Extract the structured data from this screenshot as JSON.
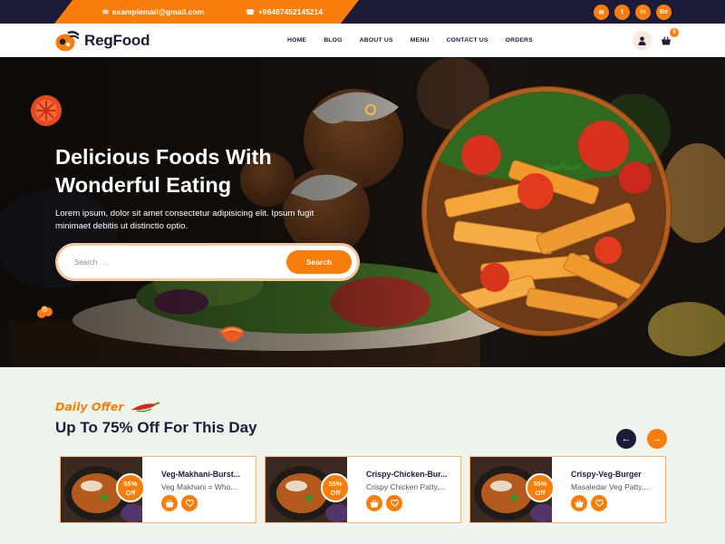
{
  "topbar": {
    "email": "examplemail@gmail.com",
    "phone": "+96487452145214",
    "socials": [
      {
        "icon": "mail-icon",
        "glyph": "✉"
      },
      {
        "icon": "twitter-icon",
        "glyph": "t"
      },
      {
        "icon": "linkedin-icon",
        "glyph": "in"
      },
      {
        "icon": "behance-icon",
        "glyph": "Be"
      }
    ]
  },
  "header": {
    "brand": "RegFood",
    "nav": [
      "HOME",
      "BLOG",
      "ABOUT US",
      "MENU",
      "CONTACT US",
      "ORDERS"
    ],
    "cart_count": "0"
  },
  "hero": {
    "title": "Delicious Foods With Wonderful Eating",
    "description": "Lorem ipsum, dolor sit amet consectetur adipisicing elit. Ipsum fugit minimaet debitis ut distinctio optio.",
    "search_placeholder": "Search . . .",
    "search_button": "Search"
  },
  "offer": {
    "tag": "Daily Offer",
    "title": "Up To 75% Off For This Day",
    "cards": [
      {
        "title": "Veg-Makhani-Burst...",
        "subtitle": "Veg Makhani = Who...",
        "badge_pct": "55%",
        "badge_off": "Off"
      },
      {
        "title": "Crispy-Chicken-Bur...",
        "subtitle": "Crispy Chicken Patty,...",
        "badge_pct": "55%",
        "badge_off": "Off"
      },
      {
        "title": "Crispy-Veg-Burger",
        "subtitle": "Masaledar Veg Patty,...",
        "badge_pct": "55%",
        "badge_off": "Off"
      }
    ]
  },
  "colors": {
    "accent": "#f97d0b",
    "navy": "#1c1b3a",
    "offer_bg": "#eef4ec"
  }
}
